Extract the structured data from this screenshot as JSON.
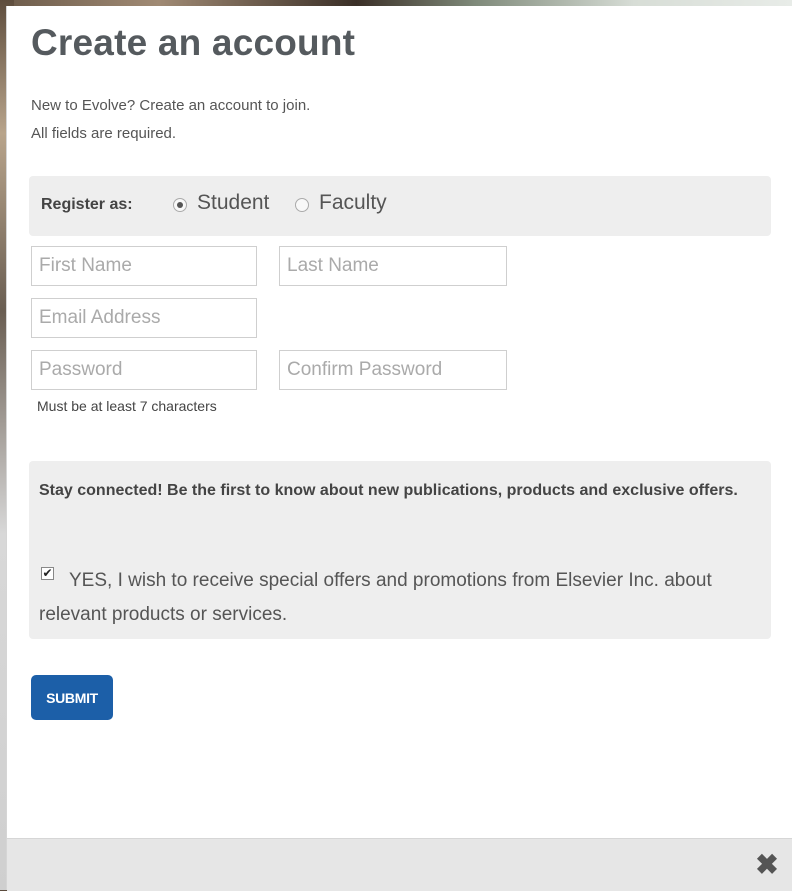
{
  "dialog": {
    "title": "Create an account",
    "intro_line1": "New to Evolve? Create an account to join.",
    "intro_line2": "All fields are required."
  },
  "register": {
    "label": "Register as:",
    "options": [
      {
        "label": "Student",
        "selected": true
      },
      {
        "label": "Faculty",
        "selected": false
      }
    ]
  },
  "fields": {
    "first_name_placeholder": "First Name",
    "last_name_placeholder": "Last Name",
    "email_placeholder": "Email Address",
    "password_placeholder": "Password",
    "confirm_password_placeholder": "Confirm Password",
    "password_hint": "Must be at least 7 characters"
  },
  "connect": {
    "heading": "Stay connected! Be the first to know about new publications, products and exclusive offers.",
    "consent_checked": true,
    "consent_label": "YES, I wish to receive special offers and promotions from Elsevier Inc. about relevant products or services."
  },
  "actions": {
    "submit_label": "SUBMIT",
    "close_icon": "close-icon"
  },
  "colors": {
    "submit_bg": "#1c5fa8",
    "panel_bg": "#eeeeee"
  }
}
